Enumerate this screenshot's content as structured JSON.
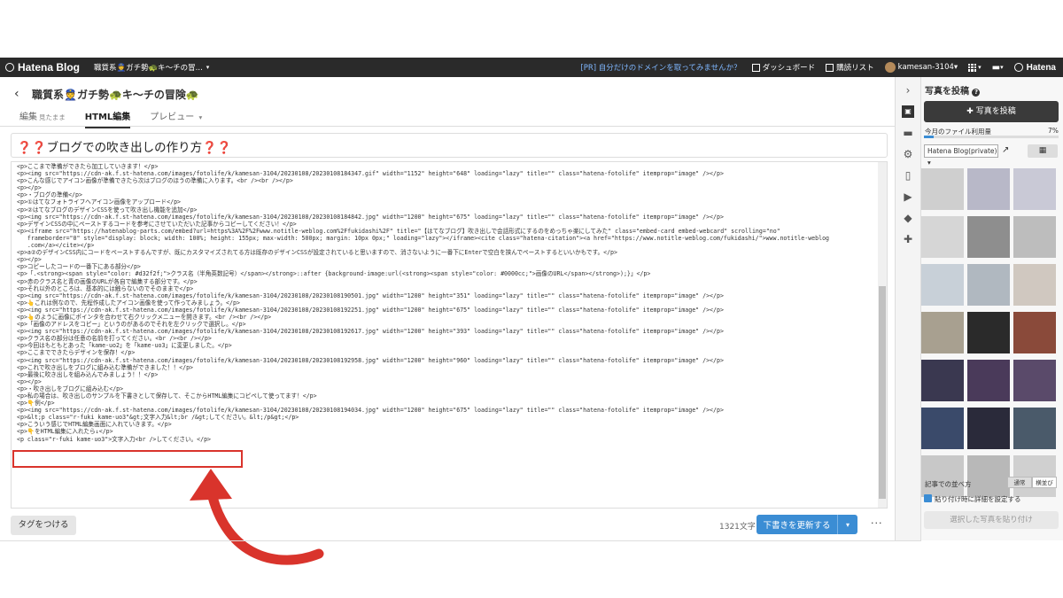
{
  "topbar": {
    "logo": "Hatena Blog",
    "blog_name": "職質系👮ガチ勢🐢キ〜チの冒...",
    "caret": "▾",
    "pr_text": "[PR] 自分だけのドメインを取ってみませんか？",
    "dashboard": "ダッシュボード",
    "reading_list": "購読リスト",
    "username": "kamesan-3104▾",
    "brand": "Hatena"
  },
  "editor": {
    "back_icon": "chevron-left-icon",
    "blog_title": "職質系👮ガチ勢🐢キ〜チの冒険🐢",
    "tabs": [
      {
        "label": "編集",
        "sub": "見たまま"
      },
      {
        "label": "HTML編集",
        "sub": ""
      },
      {
        "label": "プレビュー",
        "sub": "▾"
      }
    ],
    "post_title": "❓❓ブログでの吹き出しの作り方❓❓",
    "code_lines": [
      "<p>ここまで準備ができたら加工していきます！</p>",
      "<p><img src=\"https://cdn-ak.f.st-hatena.com/images/fotolife/k/kamesan-3104/20230108/20230108184347.gif\" width=\"1152\" height=\"648\" loading=\"lazy\" title=\"\" class=\"hatena-fotolife\" itemprop=\"image\" /></p>",
      "<p>こんな感じでアイコン画像が準備できたら次はブログのほうの準備に入ります。<br /><br /></p>",
      "<p></p>",
      "<p>・ブログの準備</p>",
      "<p>①はてなフォトライフへアイコン画像をアップロード</p>",
      "<p>②はてなブログのデザインCSSを使って吹き出し機能を追加</p>",
      "<p><img src=\"https://cdn-ak.f.st-hatena.com/images/fotolife/k/kamesan-3104/20230108/20230108184842.jpg\" width=\"1200\" height=\"675\" loading=\"lazy\" title=\"\" class=\"hatena-fotolife\" itemprop=\"image\" /></p>",
      "<p>デザインCSSの中にペーストするコードを参考にさせていただいた記事からコピーしてください！</p>",
      "<p><iframe src=\"https://hatenablog-parts.com/embed?url=https%3A%2F%2Fwww.notitle-weblog.com%2Ffukidashi%2F\" title=\"【はてなブログ】吹き出しで会話形式にするのをめっちゃ楽にしてみた\" class=\"embed-card embed-webcard\" scrolling=\"no\"",
      "   frameborder=\"0\" style=\"display: block; width: 100%; height: 155px; max-width: 500px; margin: 10px 0px;\" loading=\"lazy\"></iframe><cite class=\"hatena-citation\"><a href=\"https://www.notitle-weblog.com/fukidashi/\">www.notitle-weblog",
      "   .com</a></cite></p>",
      "<p>a②のデザインCSS内にコードをペーストするんですが、既にカスタマイズされてる方は既存のデザインCSSが設定されていると思いますので、消さないように一番下にEnterで空白を挟んでペーストするといいかもです。</p>",
      "<p></p>",
      "<p>コピーしたコードの一番下にある部分</p>",
      "<p>「.<strong><span style=\"color: #d32f2f;\">クラス名（半角英数記号）</span></strong>::after {background-image:url(<strong><span style=\"color: #0000cc;\">画像のURL</span></strong>);}」</p>",
      "<p>赤のクラス名と青の画像のURLが各自で編集する部分です。</p>",
      "<p>それ以外のところは、基本的には触らないのでそのままで</p>",
      "<p><img src=\"https://cdn-ak.f.st-hatena.com/images/fotolife/k/kamesan-3104/20230108/20230108190501.jpg\" width=\"1200\" height=\"351\" loading=\"lazy\" title=\"\" class=\"hatena-fotolife\" itemprop=\"image\" /></p>",
      "<p>👆これは例なので、先程作成したアイコン画像を使って作ってみましょう。</p>",
      "<p><img src=\"https://cdn-ak.f.st-hatena.com/images/fotolife/k/kamesan-3104/20230108/20230108192251.jpg\" width=\"1200\" height=\"675\" loading=\"lazy\" title=\"\" class=\"hatena-fotolife\" itemprop=\"image\" /></p>",
      "<p>👆のように画像にポインタを合わせて右クリックメニューを開きます。<br /><br /></p>",
      "<p>「画像のアドレスをコピー」というのがあるのでそれを左クリックで選択し。</p>",
      "<p><img src=\"https://cdn-ak.f.st-hatena.com/images/fotolife/k/kamesan-3104/20230108/20230108192617.jpg\" width=\"1200\" height=\"393\" loading=\"lazy\" title=\"\" class=\"hatena-fotolife\" itemprop=\"image\" /></p>",
      "<p>クラス名の部分は任意の名前を打ってください。<br /><br /></p>",
      "<p>今回はもともとあった「kame-uo2」を「kame-uo3」に変更しました。</p>",
      "<p>ここまでできたらデザインを保存！</p>",
      "<p><img src=\"https://cdn-ak.f.st-hatena.com/images/fotolife/k/kamesan-3104/20230108/20230108192958.jpg\" width=\"1200\" height=\"960\" loading=\"lazy\" title=\"\" class=\"hatena-fotolife\" itemprop=\"image\" /></p>",
      "<p>これで吹き出しをブログに組み込む準備ができました！！</p>",
      "<p>最後に吹き出しを組み込んでみましょう！！</p>",
      "<p></p>",
      "<p>・吹き出しをブログに組み込む</p>",
      "<p>私の場合は、吹き出しのサンプルを下書きとして保存して、そこからHTML編集にコピペして使ってます！</p>",
      "<p>👇例</p>",
      "<p><img src=\"https://cdn-ak.f.st-hatena.com/images/fotolife/k/kamesan-3104/20230108/20230108194034.jpg\" width=\"1200\" height=\"675\" loading=\"lazy\" title=\"\" class=\"hatena-fotolife\" itemprop=\"image\" /></p>",
      "<p>&lt;p class=\"r-fuki kame-uo3\"&gt;文字入力&lt;br /&gt;してください。&lt;/p&gt;</p>",
      "<p>こういう感じでHTML編集画面に入れていきます。</p>",
      "<p>👇をHTML編集に入れたら↓</p>",
      "<p class=\"r-fuki kame-uo3\">文字入力<br />してください。</p>"
    ],
    "tag_button": "タグをつける",
    "char_count": "1321文字",
    "update_button": "下書きを更新する",
    "update_caret": "▾",
    "more": "···"
  },
  "panel": {
    "title": "写真を投稿",
    "help_icon": "?",
    "post_button": "✚ 写真を投稿",
    "usage_label": "今月のファイル利用量",
    "usage_percent": "7%",
    "usage_value": 0.07,
    "album": "Hatena Blog(private) ▾",
    "sort_label": "記事での並べ方",
    "sort_options": [
      "通常",
      "横並び"
    ],
    "checkbox_label": "貼り付け時に詳細を設定する",
    "paste_button": "選択した写真を貼り付け",
    "thumb_colors": [
      "#cfcfcf",
      "#b8b8c8",
      "#c9c9d6",
      "#d6d6d6",
      "#8e8e8e",
      "#bdbdbd",
      "#c8d0d8",
      "#b0b8c0",
      "#d0c8c0",
      "#a8a090",
      "#2a2a2a",
      "#8a4a3a",
      "#3a3850",
      "#4a3a5a",
      "#5a4a6a",
      "#3a4a6a",
      "#2a2a3a",
      "#4a5a6a",
      "#c8c8c8",
      "#b8b8b8",
      "#d0d0d0"
    ]
  },
  "colors": {
    "topbar_bg": "#2a2a2a",
    "accent_blue": "#3b8dd4",
    "highlight_red": "#d9342c"
  }
}
